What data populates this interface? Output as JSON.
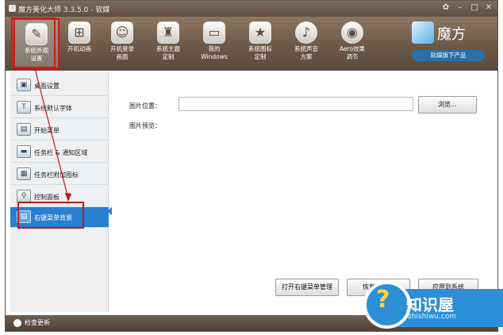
{
  "window": {
    "title": "魔方美化大师 3.3.5.0 - 软媒"
  },
  "toolbar": {
    "items": [
      {
        "label": "系统外观\n设置",
        "icon": "brush-icon"
      },
      {
        "label": "开机动画",
        "icon": "windows-logo-icon"
      },
      {
        "label": "开机登录\n画面",
        "icon": "user-icon"
      },
      {
        "label": "系统主题\n定制",
        "icon": "shirt-icon"
      },
      {
        "label": "我的\nWindows",
        "icon": "pc-icon"
      },
      {
        "label": "系统图标\n定制",
        "icon": "star-icon"
      },
      {
        "label": "系统声音\n方案",
        "icon": "music-icon"
      },
      {
        "label": "Aero效果\n调节",
        "icon": "aero-icon"
      }
    ]
  },
  "brand": {
    "name": "魔方",
    "tagline": "软媒旗下产品"
  },
  "sidebar": {
    "items": [
      {
        "label": "桌面设置",
        "icon": "desktop-icon"
      },
      {
        "label": "系统默认字体",
        "icon": "font-icon"
      },
      {
        "label": "开始菜单",
        "icon": "start-menu-icon"
      },
      {
        "label": "任务栏 & 通知区域",
        "icon": "taskbar-icon"
      },
      {
        "label": "任务栏附加图标",
        "icon": "taskbar-icons-icon"
      },
      {
        "label": "控制面板",
        "icon": "control-panel-icon"
      },
      {
        "label": "右键菜单背景",
        "icon": "context-menu-icon"
      }
    ],
    "active_index": 6
  },
  "main": {
    "image_location_label": "图片位置：",
    "image_location_value": "",
    "browse_button": "浏览...",
    "image_preview_label": "图片预览：",
    "open_manager_button": "打开右键菜单管理",
    "restore_button": "恢复到默认",
    "apply_button": "应用到系统"
  },
  "status": {
    "check_update": "检查更新"
  },
  "watermark": {
    "title": "知识屋",
    "url": "zhishiwu.com"
  },
  "colors": {
    "accent": "#2a7fd0",
    "highlight": "#d11a1a"
  }
}
